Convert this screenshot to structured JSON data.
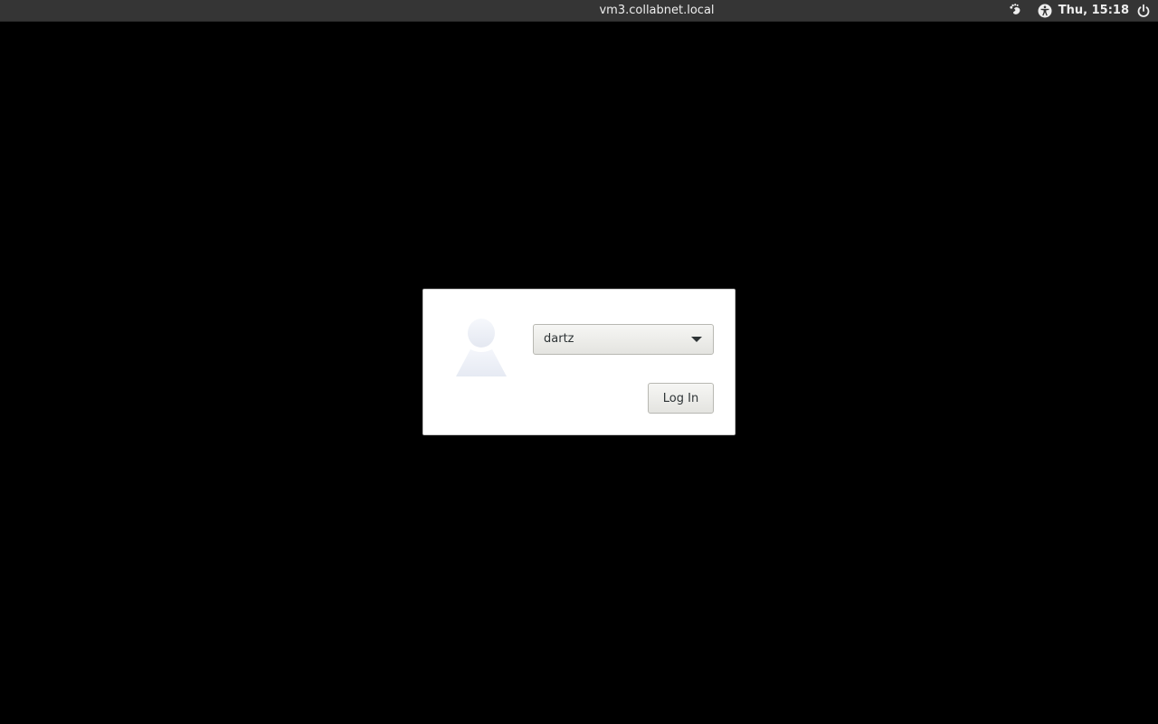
{
  "topbar": {
    "hostname": "vm3.collabnet.local",
    "clock": "Thu, 15:18",
    "icons": [
      "gnome-foot-icon",
      "accessibility-icon",
      "power-icon"
    ],
    "background_color": "#353535"
  },
  "login": {
    "avatar_icon": "default-user-avatar-icon",
    "user_select": {
      "selected": "dartz",
      "icon": "dropdown-arrow-icon"
    },
    "login_button_label": "Log In"
  },
  "colors": {
    "background": "#000000",
    "dialog": "#ffffff",
    "text": "#2e3436"
  }
}
